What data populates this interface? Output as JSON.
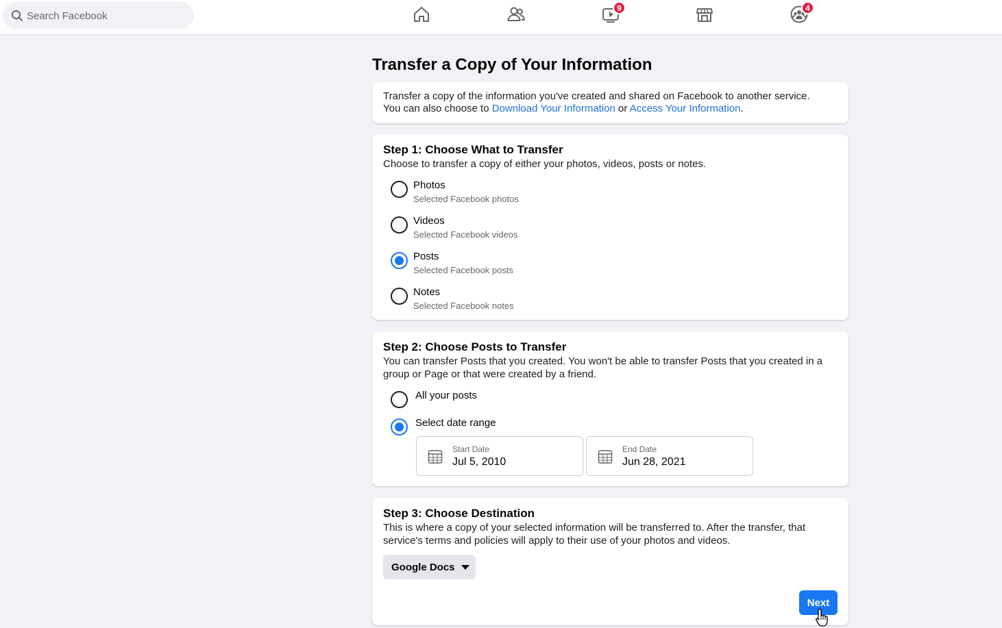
{
  "search": {
    "placeholder": "Search Facebook"
  },
  "nav": {
    "items": [
      {
        "name": "home",
        "icon": "home-icon"
      },
      {
        "name": "friends",
        "icon": "friends-icon"
      },
      {
        "name": "watch",
        "icon": "watch-icon",
        "badge": "9"
      },
      {
        "name": "marketplace",
        "icon": "marketplace-icon"
      },
      {
        "name": "groups",
        "icon": "groups-icon",
        "badge": "4"
      }
    ]
  },
  "page": {
    "title": "Transfer a Copy of Your Information",
    "intro": {
      "line1": "Transfer a copy of the information you've created and shared on Facebook to another service.",
      "line2_prefix": "You can also choose to ",
      "link1": "Download Your Information",
      "middle": " or ",
      "link2": "Access Your Information",
      "suffix": "."
    }
  },
  "step1": {
    "title": "Step 1: Choose What to Transfer",
    "description": "Choose to transfer a copy of either your photos, videos, posts or notes.",
    "options": [
      {
        "label": "Photos",
        "sub": "Selected Facebook photos",
        "checked": false
      },
      {
        "label": "Videos",
        "sub": "Selected Facebook videos",
        "checked": false
      },
      {
        "label": "Posts",
        "sub": "Selected Facebook posts",
        "checked": true
      },
      {
        "label": "Notes",
        "sub": "Selected Facebook notes",
        "checked": false
      }
    ]
  },
  "step2": {
    "title": "Step 2: Choose Posts to Transfer",
    "description_line1": "You can transfer Posts that you created. You won't be able to transfer Posts that you created in a",
    "description_line2": "group or Page or that were created by a friend.",
    "options": [
      {
        "label": "All your posts",
        "checked": false
      },
      {
        "label": "Select date range",
        "checked": true
      }
    ],
    "start_date": {
      "label": "Start Date",
      "value": "Jul 5, 2010"
    },
    "end_date": {
      "label": "End Date",
      "value": "Jun 28, 2021"
    }
  },
  "step3": {
    "title": "Step 3: Choose Destination",
    "description_line1": "This is where a copy of your selected information will be transferred to. After the transfer, that",
    "description_line2": "service's terms and policies will apply to their use of your photos and videos.",
    "destination": "Google Docs",
    "next_label": "Next"
  },
  "colors": {
    "accent": "#1877f2",
    "link": "#216fdb",
    "badge": "#e41e3f",
    "background": "#f0f2f5"
  }
}
